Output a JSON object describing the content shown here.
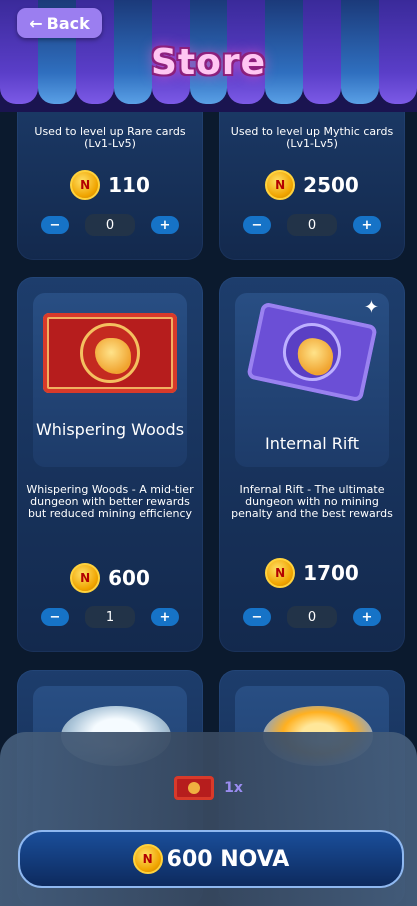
{
  "header": {
    "back_label": "Back",
    "title": "Store"
  },
  "cards": [
    {
      "desc": "Used to level up Rare cards (Lv1-Lv5)",
      "price": "110",
      "qty": "0"
    },
    {
      "desc": "Used to level up Mythic cards (Lv1-Lv5)",
      "price": "2500",
      "qty": "0"
    },
    {
      "title": "Whispering Woods",
      "desc": "Whispering Woods - A mid-tier dungeon with better rewards but reduced mining efficiency",
      "price": "600",
      "qty": "1"
    },
    {
      "title": "Internal Rift",
      "desc": "Infernal Rift - The ultimate dungeon with no mining penalty and the best rewards",
      "price": "1700",
      "qty": "0"
    }
  ],
  "controls": {
    "minus": "−",
    "plus": "+"
  },
  "checkout": {
    "item_count": "1x",
    "pay_label": "600 NOVA"
  },
  "colors": {
    "accent": "#9b7ef0",
    "button_blue": "#1673c7",
    "coin_gold": "#f0a400"
  },
  "icons": {
    "coin": "nova-coin-icon",
    "back": "arrow-left-icon"
  }
}
